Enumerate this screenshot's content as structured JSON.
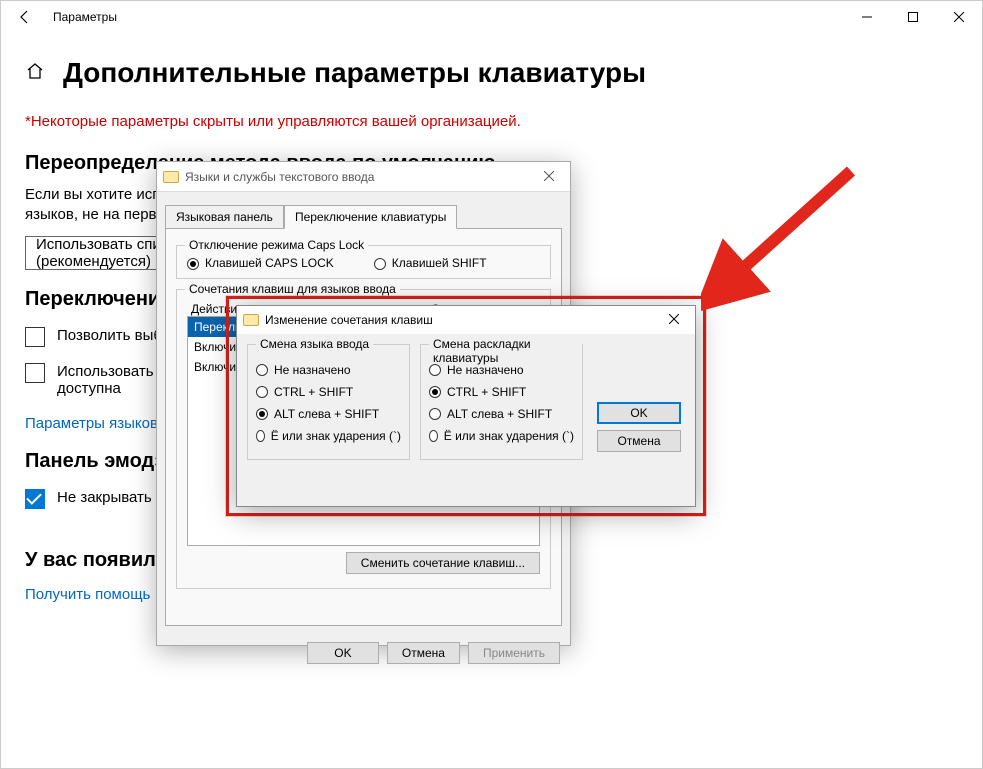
{
  "window": {
    "title": "Параметры"
  },
  "page": {
    "heading": "Дополнительные параметры клавиатуры",
    "org_notice": "*Некоторые параметры скрыты или управляются вашей организацией."
  },
  "override_section": {
    "heading": "Переопределение метода ввода по умолчанию",
    "body": "Если вы хотите использовать метод ввода, отличный от первого в списке языков, не на первом месте в вашем списке языков, выберите его здесь.",
    "dropdown_value": "Использовать список языков (рекомендуется)"
  },
  "switch_section": {
    "heading": "Переключение методов ввода",
    "cb1": "Позволить выбирать метод ввода для каждого приложения",
    "cb2": "Использовать языковую панель на рабочем столе, если она доступна",
    "link": "Параметры языковой панели"
  },
  "emoji_section": {
    "heading": "Панель эмодзи",
    "cb": "Не закрывать панель автоматически после ввода эмодзи"
  },
  "help_section": {
    "heading": "У вас появились вопросы?",
    "link": "Получить помощь"
  },
  "dlg1": {
    "title": "Языки и службы текстового ввода",
    "tab1": "Языковая панель",
    "tab2": "Переключение клавиатуры",
    "capslock_group": "Отключение режима Caps Lock",
    "caps_opt1": "Клавишей CAPS LOCK",
    "caps_opt2": "Клавишей SHIFT",
    "hotkey_group": "Сочетания клавиш для языков ввода",
    "col_action": "Действие",
    "col_keys": "Сочетание клавиш",
    "rows": [
      "Переключить язык ввода",
      "Включить Русский",
      "Включить Английский (США)"
    ],
    "change_btn": "Сменить сочетание клавиш...",
    "ok": "OK",
    "cancel": "Отмена",
    "apply": "Применить"
  },
  "dlg2": {
    "title": "Изменение сочетания клавиш",
    "groupA": "Смена языка ввода",
    "groupB": "Смена раскладки клавиатуры",
    "opts": {
      "none": "Не назначено",
      "ctrl_shift": "CTRL + SHIFT",
      "alt_shift": "ALT слева + SHIFT",
      "grave": "Ё или знак ударения (`)"
    },
    "selectedA": "alt_shift",
    "selectedB": "ctrl_shift",
    "ok": "OK",
    "cancel": "Отмена"
  }
}
